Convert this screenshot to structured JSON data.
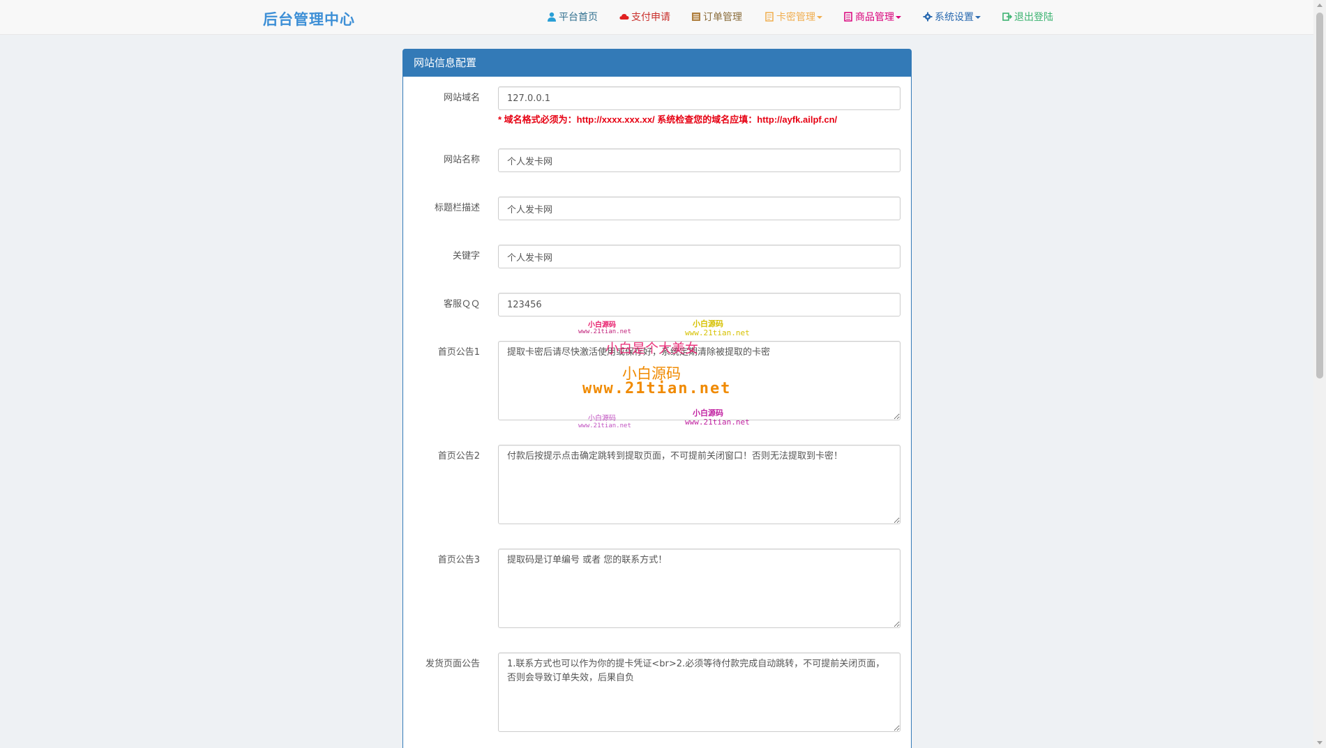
{
  "brand": "后台管理中心",
  "nav": [
    {
      "label": "平台首页",
      "icon": "user-icon",
      "color": "#31708f",
      "dropdown": false
    },
    {
      "label": "支付申请",
      "icon": "cloud-icon",
      "color": "#c9302c",
      "dropdown": false
    },
    {
      "label": "订单管理",
      "icon": "list-icon",
      "color": "#8a6d3b",
      "dropdown": false
    },
    {
      "label": "卡密管理",
      "icon": "file-icon",
      "color": "#f0ad4e",
      "dropdown": true
    },
    {
      "label": "商品管理",
      "icon": "book-icon",
      "color": "#d9007a",
      "dropdown": true
    },
    {
      "label": "系统设置",
      "icon": "gear-icon",
      "color": "#2a6ab0",
      "dropdown": true
    },
    {
      "label": "退出登陆",
      "icon": "logout-icon",
      "color": "#3cb371",
      "dropdown": false
    }
  ],
  "panel": {
    "title": "网站信息配置"
  },
  "form": {
    "domain_label": "网站域名",
    "domain_value": "127.0.0.1",
    "domain_hint": "* 域名格式必须为：http://xxxx.xxx.xx/ 系统检查您的域名应填：http://ayfk.ailpf.cn/",
    "name_label": "网站名称",
    "name_value": "个人发卡网",
    "title_label": "标题栏描述",
    "title_value": "个人发卡网",
    "keywords_label": "关键字",
    "keywords_value": "个人发卡网",
    "qq_label": "客服ＱＱ",
    "qq_value": "123456",
    "notice1_label": "首页公告1",
    "notice1_value": "提取卡密后请尽快激活使用或保存好，系统定期清除被提取的卡密",
    "notice2_label": "首页公告2",
    "notice2_value": "付款后按提示点击确定跳转到提取页面，不可提前关闭窗口！否则无法提取到卡密！",
    "notice3_label": "首页公告3",
    "notice3_value": "提取码是订单编号 或者 您的联系方式！",
    "delivery_label": "发货页面公告",
    "delivery_value": "1.联系方式也可以作为你的提卡凭证<br>2.必须等待付款完成自动跳转，不可提前关闭页面，否则会导致订单失效，后果自负"
  },
  "watermark": {
    "small1": "小白源码",
    "small1_url": "www.21tian.net",
    "big_line1": "小白是个大美女",
    "big_line2": "小白源码",
    "big_line3": "www.21tian.net"
  }
}
